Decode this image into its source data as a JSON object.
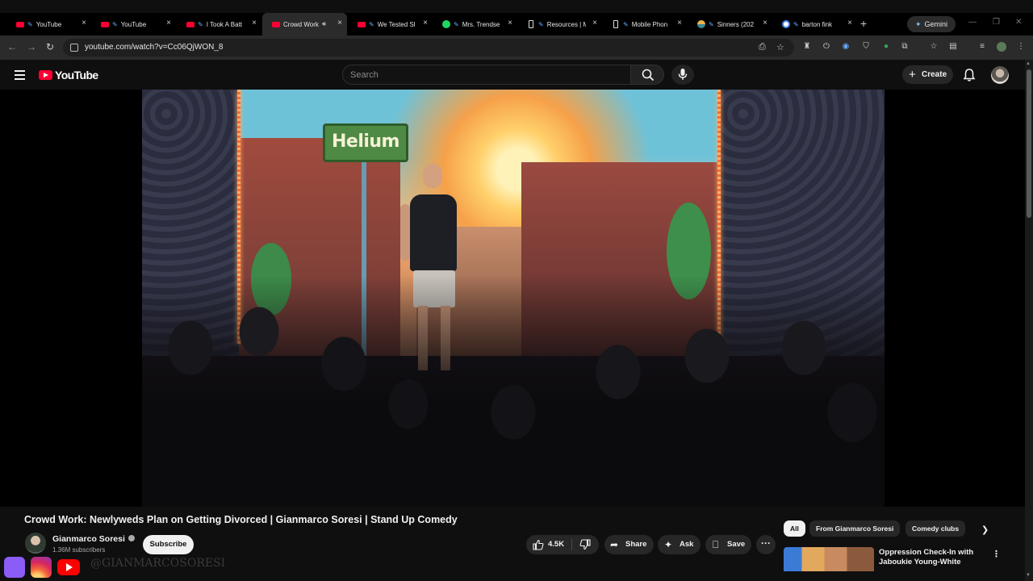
{
  "browser": {
    "tabs": [
      {
        "title": "YouTube",
        "favicon": "youtube-icon",
        "active": false
      },
      {
        "title": "YouTube",
        "favicon": "youtube-icon",
        "active": false
      },
      {
        "title": "I Took A Batt",
        "favicon": "youtube-icon",
        "active": false
      },
      {
        "title": "Crowd Work:",
        "favicon": "youtube-icon",
        "active": true,
        "audio": true
      },
      {
        "title": "We Tested Sl",
        "favicon": "youtube-icon",
        "active": false
      },
      {
        "title": "Mrs. Trendse",
        "favicon": "spotify-icon",
        "active": false
      },
      {
        "title": "Resources | M",
        "favicon": "phone-icon",
        "active": false
      },
      {
        "title": "Mobile Phon",
        "favicon": "phone-icon",
        "active": false
      },
      {
        "title": "Sinners (202",
        "favicon": "sinners-icon",
        "active": false
      },
      {
        "title": "barton fink",
        "favicon": "google-icon",
        "active": false
      }
    ],
    "gemini_label": "Gemini",
    "url": "youtube.com/watch?v=Cc06QjWON_8"
  },
  "youtube": {
    "logo_text": "YouTube",
    "search_placeholder": "Search",
    "create_label": "Create"
  },
  "video": {
    "sign_text": "Helium",
    "title": "Crowd Work: Newlyweds Plan on Getting Divorced | Gianmarco Soresi | Stand Up Comedy",
    "channel": "Gianmarco Soresi",
    "subscribers": "1.36M subscribers",
    "subscribe_label": "Subscribe",
    "likes": "4.5K",
    "share_label": "Share",
    "ask_label": "Ask",
    "save_label": "Save"
  },
  "sidebar": {
    "chips": [
      "All",
      "From Gianmarco Soresi",
      "Comedy clubs"
    ],
    "recommendation": {
      "title": "Oppression Check-In with Jaboukie Young-White"
    }
  },
  "overlay": {
    "handle": "@GIANMARCOSORESI"
  },
  "colors": {
    "background": "#0f0f0f",
    "youtube_red": "#ff0033",
    "chip_bg": "#272727",
    "text": "#f1f1f1"
  }
}
